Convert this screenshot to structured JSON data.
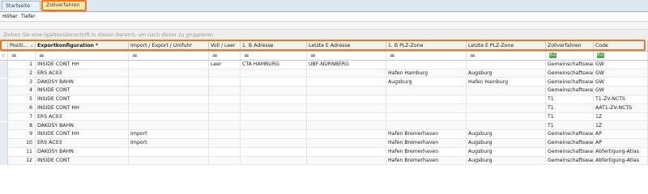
{
  "tabs": [
    {
      "label": "Startseite"
    },
    {
      "label": "Zollverfahren",
      "close": "×"
    }
  ],
  "menu": [
    "Höher",
    "Tiefer"
  ],
  "group_hint": "Ziehen Sie eine Spaltenüberschrift in diesen Bereich, um nach dieser zu gruppieren",
  "columns": [
    "Positi…",
    "Exportkonfiguration *",
    "Import / Export / Umfuhr",
    "Voll / Leer",
    "1. B Adresse",
    "Letzte E Adresse",
    "1. B PLZ-Zone",
    "Letzte E PLZ-Zone",
    "Zollverfahren",
    "Code"
  ],
  "sort_indicator": "▵",
  "filter_symbol": "=",
  "filter_regex": "R:C",
  "rows": [
    [
      "1",
      "INSIDE CONT HH",
      "",
      "Leer",
      "CTA HAMBURG",
      "UBF-NÜRNBERG",
      "",
      "",
      "Gemeinschaftsware",
      "GW"
    ],
    [
      "2",
      "ERS AC03",
      "",
      "",
      "",
      "",
      "Hafen Hamburg",
      "Augsburg",
      "Gemeinschaftsware",
      "GW"
    ],
    [
      "3",
      "DAKOSY BAHN",
      "",
      "",
      "",
      "",
      "Augsburg",
      "Hafen Hamburg",
      "Gemeinschaftsware",
      "GW"
    ],
    [
      "4",
      "INSIDE CONT",
      "",
      "",
      "",
      "",
      "",
      "",
      "Gemeinschaftsware",
      "GW"
    ],
    [
      "5",
      "INSIDE CONT",
      "",
      "",
      "",
      "",
      "",
      "",
      "T1",
      "T1-ZV-NCTS"
    ],
    [
      "6",
      "INSIDE CONT HH",
      "",
      "",
      "",
      "",
      "",
      "",
      "T1",
      "AAT1-ZV-NCTS"
    ],
    [
      "7",
      "ERS AC03",
      "",
      "",
      "",
      "",
      "",
      "",
      "T1",
      "1Z"
    ],
    [
      "8",
      "DAKOSY BAHN",
      "",
      "",
      "",
      "",
      "",
      "",
      "T1",
      "1Z"
    ],
    [
      "9",
      "INSIDE CONT HH",
      "Import",
      "",
      "",
      "",
      "Hafen Bremerhaven",
      "Augsburg",
      "Gemeinschaftsware",
      "AP"
    ],
    [
      "10",
      "ERS AC03",
      "Import",
      "",
      "",
      "",
      "Hafen Bremerhaven",
      "Augsburg",
      "Gemeinschaftsware",
      "AP"
    ],
    [
      "11",
      "DAKOSY BAHN",
      "",
      "",
      "",
      "",
      "Hafen Bremerhaven",
      "Augsburg",
      "Gemeinschaftsware",
      "Abfertigung-Atlas"
    ],
    [
      "12",
      "INSIDE CONT",
      "",
      "",
      "",
      "",
      "Hafen Bremerhaven",
      "Augsburg",
      "Gemeinschaftsware",
      "Abfertigung-Atlas"
    ]
  ]
}
